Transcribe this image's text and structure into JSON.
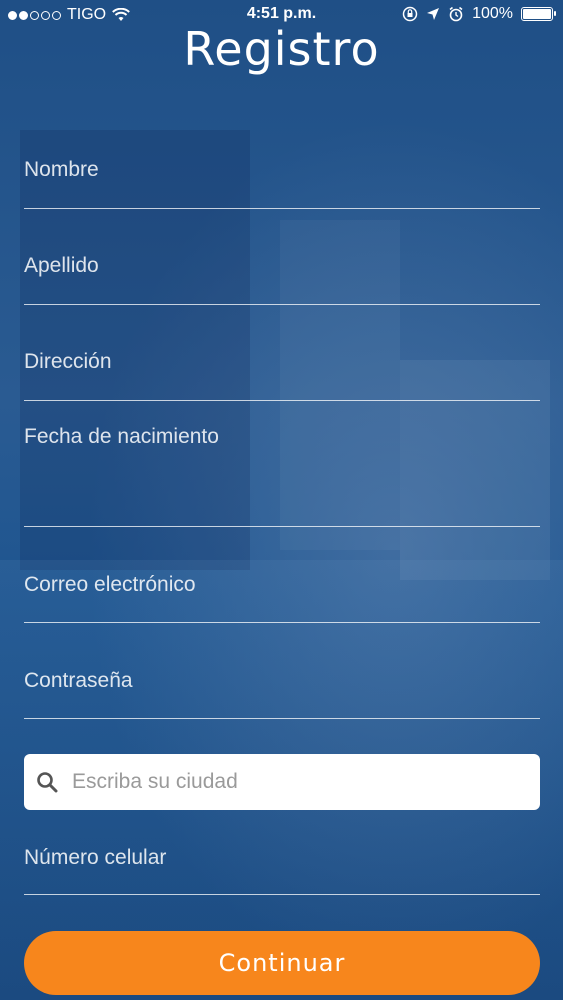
{
  "status_bar": {
    "carrier": "TIGO",
    "time": "4:51 p.m.",
    "battery": "100%",
    "battery_level": 1.0,
    "signal_bars_filled": 2,
    "signal_bars_total": 5,
    "icons": [
      "wifi-icon",
      "orientation-lock-icon",
      "location-icon",
      "alarm-icon",
      "battery-icon"
    ]
  },
  "header": {
    "title": "Registro"
  },
  "form": {
    "name_label": "Nombre",
    "lastname_label": "Apellido",
    "address_label": "Dirección",
    "birthdate_label": "Fecha de nacimiento",
    "email_label": "Correo electrónico",
    "password_label": "Contraseña",
    "city_placeholder": "Escriba su ciudad",
    "city_value": "",
    "phone_label": "Número celular",
    "continue_label": "Continuar"
  },
  "colors": {
    "background": "#1f4f86",
    "accent": "#f7861c",
    "text": "#ffffff"
  }
}
